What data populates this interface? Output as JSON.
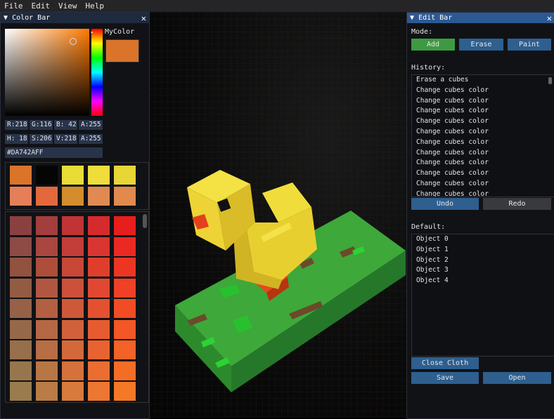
{
  "menu": [
    "File",
    "Edit",
    "View",
    "Help"
  ],
  "color_bar": {
    "title": "Color Bar",
    "close": "✕",
    "mycolor_label": "MyColor",
    "mycolor_hex": "#DA742A",
    "rgba": [
      "R:218",
      "G:116",
      "B: 42",
      "A:255"
    ],
    "hsva": [
      "H: 18",
      "S:206",
      "V:218",
      "A:255"
    ],
    "hex": "#DA742AFF",
    "palette": [
      "#da742a",
      "#050505",
      "#e8dc37",
      "#eedd3a",
      "#e8d636",
      "#e57f5a",
      "#e3693c",
      "#d48c2c",
      "#e08a52",
      "#e08a4e"
    ],
    "grid": [
      [
        "#8a4040",
        "#a43d3d",
        "#c03435",
        "#d52b2c",
        "#e81e1c"
      ],
      [
        "#8e4a44",
        "#a94640",
        "#c33d39",
        "#da3531",
        "#ea2a22"
      ],
      [
        "#91523f",
        "#ad4e3b",
        "#c94737",
        "#df3e2d",
        "#ed3523"
      ],
      [
        "#935a44",
        "#b15741",
        "#cc503a",
        "#e24831",
        "#f04025"
      ],
      [
        "#956248",
        "#b35f42",
        "#ce583a",
        "#e45130",
        "#f14c25"
      ],
      [
        "#96684a",
        "#b66744",
        "#d1613b",
        "#e75b30",
        "#f25725"
      ],
      [
        "#976f4c",
        "#b76e45",
        "#d3693b",
        "#e96330",
        "#f36226"
      ],
      [
        "#98764d",
        "#b97645",
        "#d5723b",
        "#eb6d31",
        "#f46d26"
      ],
      [
        "#997b4e",
        "#ba7c46",
        "#d77a3c",
        "#ec7632",
        "#f57827"
      ]
    ]
  },
  "edit_bar": {
    "title": "Edit Bar",
    "close": "✕",
    "mode_label": "Mode:",
    "modes": [
      "Add",
      "Erase",
      "Paint"
    ],
    "history_label": "History:",
    "history": [
      "Erase a cubes",
      "Change cubes color",
      "Change cubes color",
      "Change cubes color",
      "Change cubes color",
      "Change cubes color",
      "Change cubes color",
      "Change cubes color",
      "Change cubes color",
      "Change cubes color",
      "Change cubes color",
      "Change cubes color"
    ],
    "undo": "Undo",
    "redo": "Redo",
    "default_label": "Default:",
    "objects": [
      "Object 0",
      "Object 1",
      "Object 2",
      "Object 3",
      "Object 4"
    ],
    "close_cloth": "Close Cloth",
    "save": "Save",
    "open": "Open"
  }
}
